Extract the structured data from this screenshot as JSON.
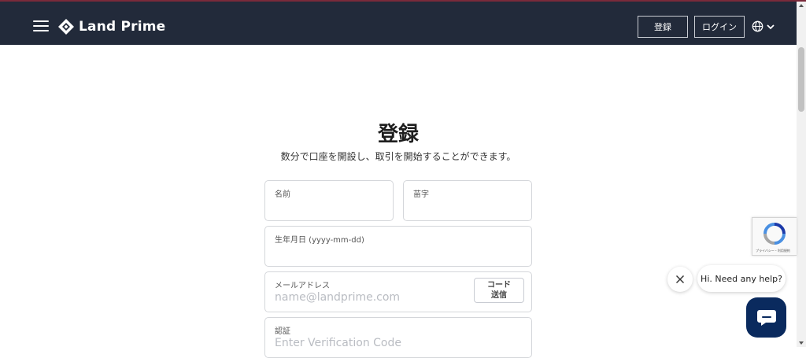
{
  "header": {
    "brand": "Land Prime",
    "register_label": "登録",
    "login_label": "ログイン"
  },
  "main": {
    "title": "登録",
    "subtitle": "数分で口座を開設し、取引を開始することができます。"
  },
  "form": {
    "first_name": {
      "label": "名前",
      "placeholder": ""
    },
    "last_name": {
      "label": "苗字",
      "placeholder": ""
    },
    "dob": {
      "label": "生年月日 (yyyy-mm-dd)",
      "placeholder": ""
    },
    "email": {
      "label": "メールアドレス",
      "placeholder": "name@landprime.com"
    },
    "send_code_line1": "コード",
    "send_code_line2": "送信",
    "verification": {
      "label": "認証",
      "placeholder": "Enter Verification Code"
    }
  },
  "recaptcha": {
    "footer": "プライバシー・利用規約"
  },
  "chat": {
    "help_text": "Hi. Need any help?"
  },
  "colors": {
    "header_bg": "#222a3a",
    "chat_button": "#0a2a5e"
  }
}
